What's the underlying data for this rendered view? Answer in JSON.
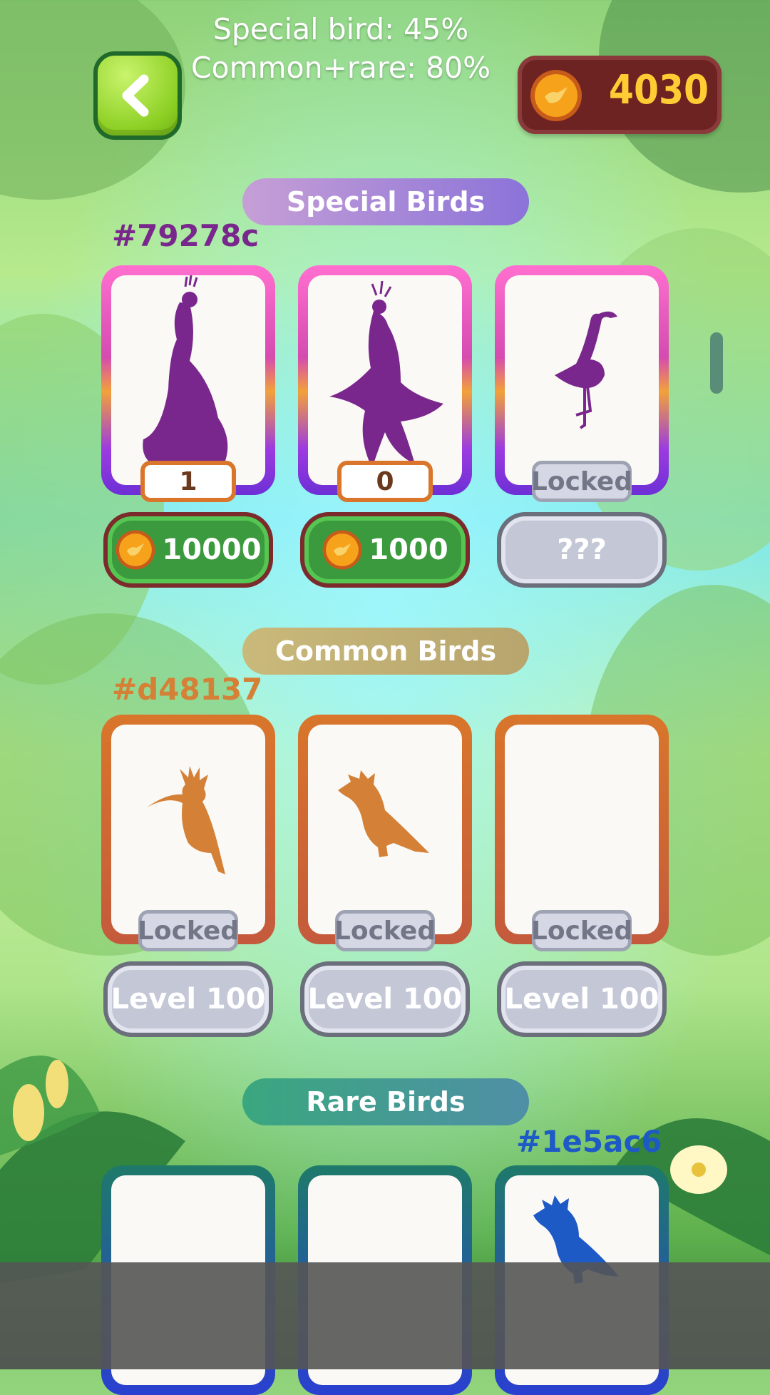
{
  "stats": {
    "special_line": "Special bird: 45%",
    "common_line": "Common+rare: 80%"
  },
  "header": {
    "back_icon": "chevron-left-icon",
    "coins": "4030"
  },
  "special": {
    "title": "Special Birds",
    "color_hex": "#79278c",
    "accent": "#79278c",
    "cards": [
      {
        "bird": "peacock",
        "count": "1",
        "price": "10000"
      },
      {
        "bird": "phoenix",
        "count": "0",
        "price": "1000"
      },
      {
        "bird": "flamingo",
        "status": "Locked",
        "price": "???"
      }
    ]
  },
  "common": {
    "title": "Common Birds",
    "color_hex": "#d48137",
    "accent": "#d48137",
    "cards": [
      {
        "bird": "hoopoe",
        "status": "Locked",
        "requirement": "Level 100"
      },
      {
        "bird": "crested-bird",
        "status": "Locked",
        "requirement": "Level 100"
      },
      {
        "bird": "none",
        "status": "Locked",
        "requirement": "Level 100"
      }
    ]
  },
  "rare": {
    "title": "Rare Birds",
    "color_hex": "#1e5ac6",
    "accent": "#1e5ac6",
    "cards": [
      {
        "bird": "none"
      },
      {
        "bird": "none"
      },
      {
        "bird": "cockatoo"
      }
    ]
  },
  "colors": {
    "green_button": "#3c9a3e",
    "coin_text": "#ffcc33",
    "panel": "#6e2323"
  }
}
